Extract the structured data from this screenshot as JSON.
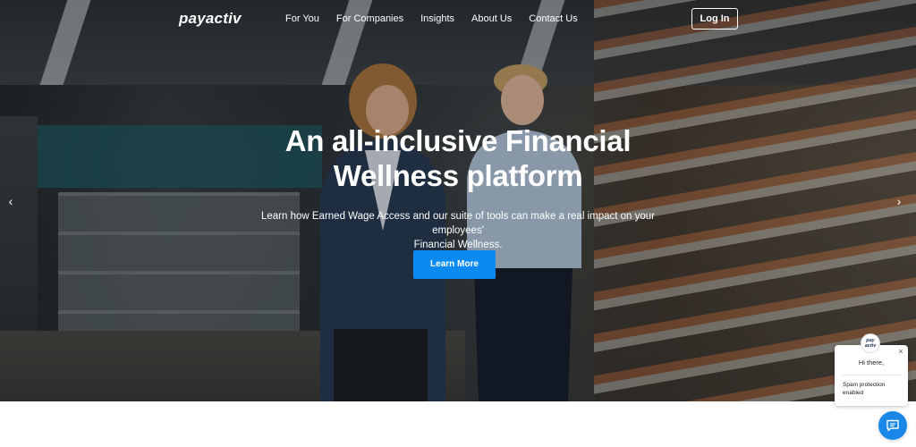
{
  "nav": {
    "logo": "payactiv",
    "links": [
      "For You",
      "For Companies",
      "Insights",
      "About Us",
      "Contact Us"
    ],
    "login_label": "Log In"
  },
  "hero": {
    "headline_line1": "An all-inclusive Financial",
    "headline_line2": "Wellness platform",
    "subtext_line1": "Learn how Earned Wage Access and our suite of tools can make a real impact on your employees'",
    "subtext_line2": "Financial Wellness.",
    "cta_label": "Learn More",
    "prev_arrow": "‹",
    "next_arrow": "›"
  },
  "chat": {
    "avatar_text": "pay activ",
    "close_symbol": "×",
    "greeting": "Hi there,",
    "note": "Spam protection enabled",
    "fab_icon": "chat-bubble-icon"
  },
  "colors": {
    "cta": "#0b8bf2",
    "chat_fab": "#1887e8",
    "text_light": "#ffffff"
  }
}
